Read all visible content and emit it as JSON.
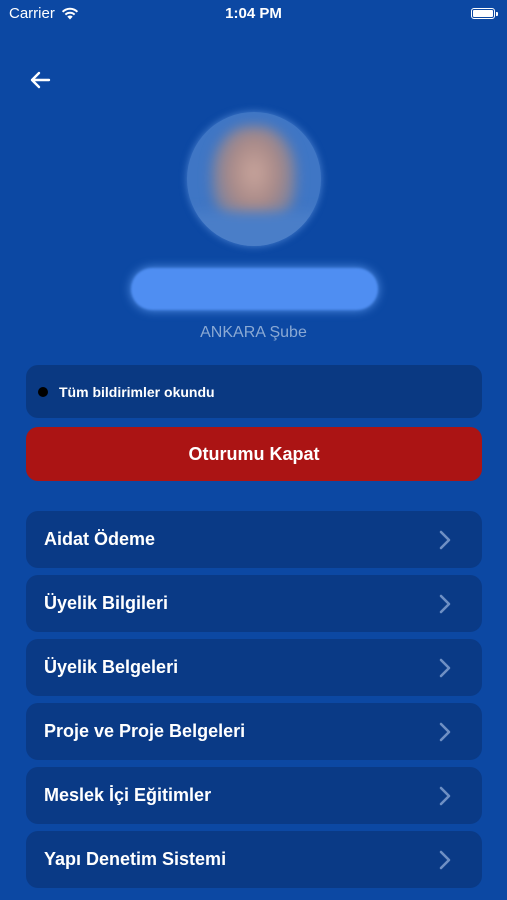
{
  "status_bar": {
    "carrier": "Carrier",
    "time": "1:04 PM"
  },
  "profile": {
    "branch": "ANKARA Şube"
  },
  "notifications": {
    "text": "Tüm bildirimler okundu"
  },
  "logout": {
    "label": "Oturumu Kapat",
    "color": "#ab1414"
  },
  "menu": {
    "items": [
      {
        "label": "Aidat Ödeme",
        "icon": "chevron-right-icon"
      },
      {
        "label": "Üyelik Bilgileri",
        "icon": "chevron-right-icon"
      },
      {
        "label": "Üyelik Belgeleri",
        "icon": "chevron-right-icon"
      },
      {
        "label": "Proje ve Proje Belgeleri",
        "icon": "chevron-right-icon"
      },
      {
        "label": "Meslek İçi Eğitimler",
        "icon": "chevron-right-icon"
      },
      {
        "label": "Yapı Denetim Sistemi",
        "icon": "chevron-right-icon"
      }
    ]
  },
  "colors": {
    "background": "#0c48a3",
    "card": "#0a3a86",
    "muted_text": "#8aa9d4"
  }
}
